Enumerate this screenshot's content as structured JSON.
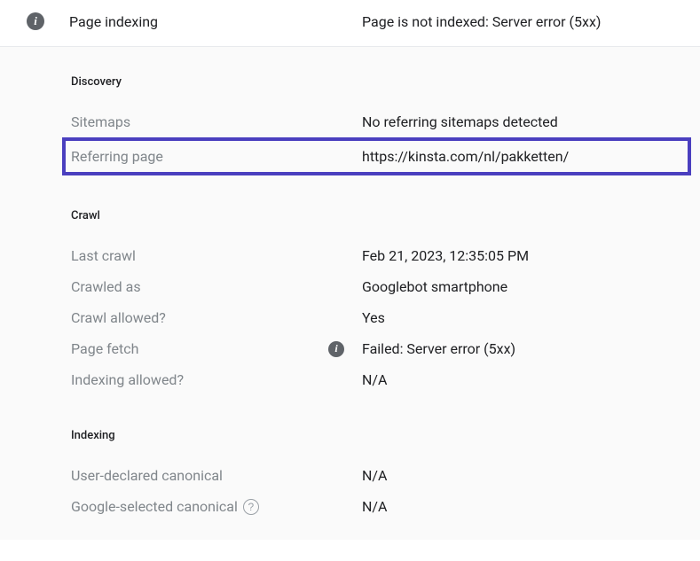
{
  "header": {
    "title": "Page indexing",
    "status": "Page is not indexed: Server error (5xx)"
  },
  "sections": {
    "discovery": {
      "title": "Discovery",
      "sitemaps": {
        "label": "Sitemaps",
        "value": "No referring sitemaps detected"
      },
      "referring": {
        "label": "Referring page",
        "value": "https://kinsta.com/nl/pakketten/"
      }
    },
    "crawl": {
      "title": "Crawl",
      "last_crawl": {
        "label": "Last crawl",
        "value": "Feb 21, 2023, 12:35:05 PM"
      },
      "crawled_as": {
        "label": "Crawled as",
        "value": "Googlebot smartphone"
      },
      "crawl_allowed": {
        "label": "Crawl allowed?",
        "value": "Yes"
      },
      "page_fetch": {
        "label": "Page fetch",
        "value": "Failed: Server error (5xx)"
      },
      "indexing_allowed": {
        "label": "Indexing allowed?",
        "value": "N/A"
      }
    },
    "indexing": {
      "title": "Indexing",
      "user_canonical": {
        "label": "User-declared canonical",
        "value": "N/A"
      },
      "google_canonical": {
        "label": "Google-selected canonical",
        "value": "N/A"
      }
    }
  }
}
